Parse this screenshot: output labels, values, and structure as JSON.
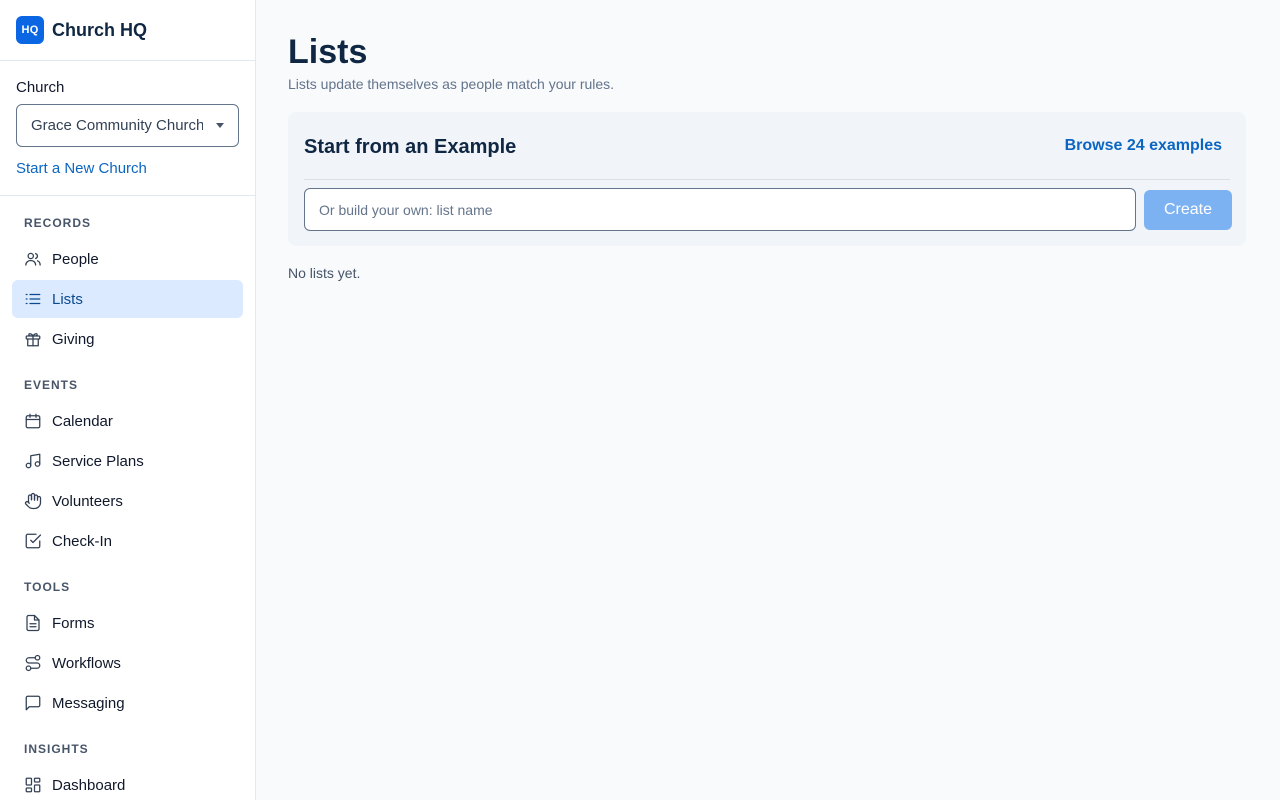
{
  "brand": {
    "logo_text": "HQ",
    "name": "Church HQ"
  },
  "church": {
    "label": "Church",
    "selected": "Grace Community Church",
    "new_church_link": "Start a New Church"
  },
  "nav": {
    "sections": [
      {
        "title": "RECORDS",
        "items": [
          {
            "label": "People",
            "icon": "users-icon",
            "active": false
          },
          {
            "label": "Lists",
            "icon": "list-icon",
            "active": true
          },
          {
            "label": "Giving",
            "icon": "gift-icon",
            "active": false
          }
        ]
      },
      {
        "title": "EVENTS",
        "items": [
          {
            "label": "Calendar",
            "icon": "calendar-icon",
            "active": false
          },
          {
            "label": "Service Plans",
            "icon": "music-icon",
            "active": false
          },
          {
            "label": "Volunteers",
            "icon": "hand-icon",
            "active": false
          },
          {
            "label": "Check-In",
            "icon": "check-square-icon",
            "active": false
          }
        ]
      },
      {
        "title": "TOOLS",
        "items": [
          {
            "label": "Forms",
            "icon": "file-icon",
            "active": false
          },
          {
            "label": "Workflows",
            "icon": "route-icon",
            "active": false
          },
          {
            "label": "Messaging",
            "icon": "message-icon",
            "active": false
          }
        ]
      },
      {
        "title": "INSIGHTS",
        "items": [
          {
            "label": "Dashboard",
            "icon": "dashboard-icon",
            "active": false
          }
        ]
      }
    ]
  },
  "page": {
    "title": "Lists",
    "subtitle": "Lists update themselves as people match your rules."
  },
  "examples": {
    "title": "Start from an Example",
    "browse_link": "Browse 24 examples",
    "input_placeholder": "Or build your own: list name",
    "input_value": "",
    "create_label": "Create"
  },
  "empty_state": "No lists yet.",
  "colors": {
    "accent": "#0b66e4",
    "link": "#0b66c2",
    "active_bg": "#dbeafe",
    "create_button": "#7db2f2"
  }
}
